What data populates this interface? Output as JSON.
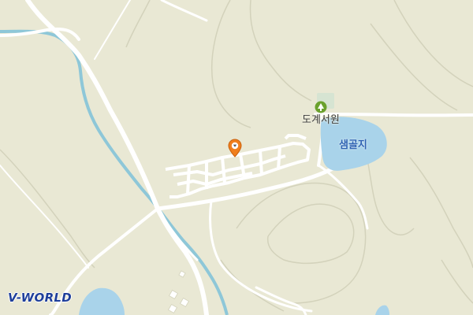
{
  "map": {
    "poi_label": "도계서원",
    "poi_icon": "tree-icon",
    "lake_label": "샘골지",
    "marker_icon": "location-marker-icon",
    "logo_text": "V-WORLD",
    "colors": {
      "land": "#e9e8d4",
      "water": "#a9d3ea",
      "stream": "#8ec7d8",
      "road": "#ffffff",
      "contour": "#d3d2bb",
      "marker": "#f07e1b",
      "poi": "#6aa12c",
      "logo": "#1f3f9a"
    }
  }
}
